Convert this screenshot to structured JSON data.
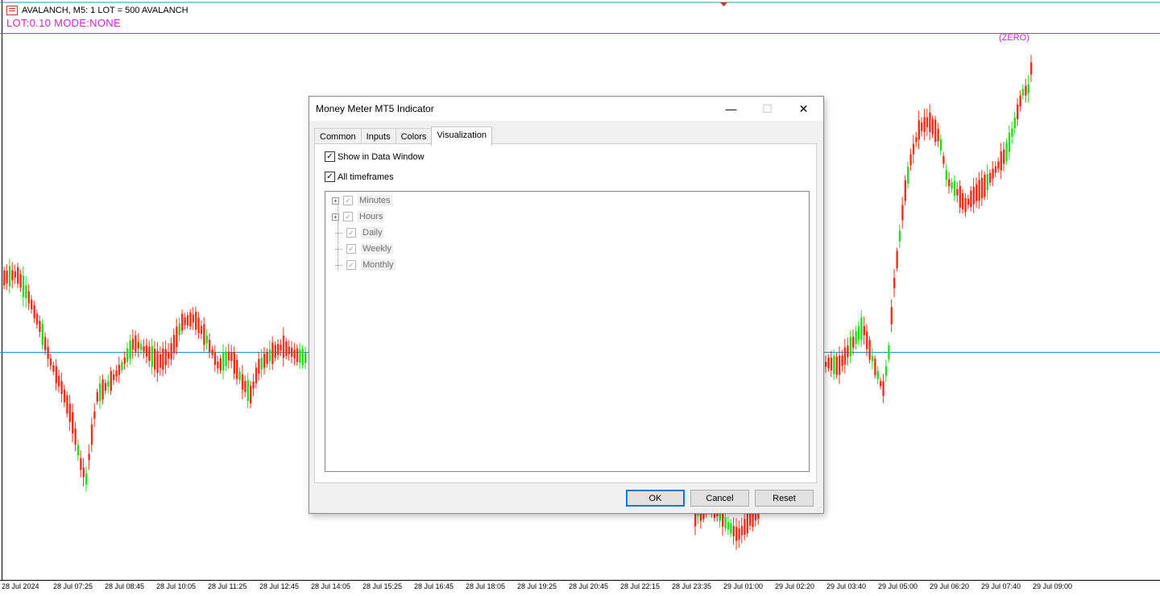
{
  "chart": {
    "header_text": "AVALANCH, M5:  1 LOT = 500 AVALANCH",
    "lot_mode_text": "LOT:0.10   MODE:NONE",
    "zero_label": "(ZERO)",
    "x_axis_labels": [
      "28 Jul 2024",
      "28 Jul 07:25",
      "28 Jul 08:45",
      "28 Jul 10:05",
      "28 Jul 11:25",
      "28 Jul 12:45",
      "28 Jul 14:05",
      "28 Jul 15:25",
      "28 Jul 16:45",
      "28 Jul 18:05",
      "28 Jul 19:25",
      "28 Jul 20:45",
      "28 Jul 22:15",
      "28 Jul 23:35",
      "29 Jul 01:00",
      "29 Jul 02:20",
      "29 Jul 03:40",
      "29 Jul 05:00",
      "29 Jul 06:20",
      "29 Jul 07:40",
      "29 Jul 09:00"
    ],
    "colors": {
      "bear": "#e8321e",
      "bull": "#22dd22",
      "magenta_line": "#d020d0",
      "blue_line": "#2a8fc8"
    }
  },
  "dialog": {
    "title": "Money Meter MT5 Indicator",
    "controls": {
      "minimize": "—",
      "maximize": "☐",
      "close": "✕"
    },
    "tabs": [
      "Common",
      "Inputs",
      "Colors",
      "Visualization"
    ],
    "active_tab": "Visualization",
    "show_in_data_window": {
      "label": "Show in Data Window",
      "checked": true
    },
    "all_timeframes": {
      "label": "All timeframes",
      "checked": true
    },
    "timeframes": [
      {
        "label": "Minutes",
        "expandable": true
      },
      {
        "label": "Hours",
        "expandable": true
      },
      {
        "label": "Daily",
        "expandable": false
      },
      {
        "label": "Weekly",
        "expandable": false
      },
      {
        "label": "Monthly",
        "expandable": false
      }
    ],
    "buttons": {
      "ok": "OK",
      "cancel": "Cancel",
      "reset": "Reset"
    }
  }
}
